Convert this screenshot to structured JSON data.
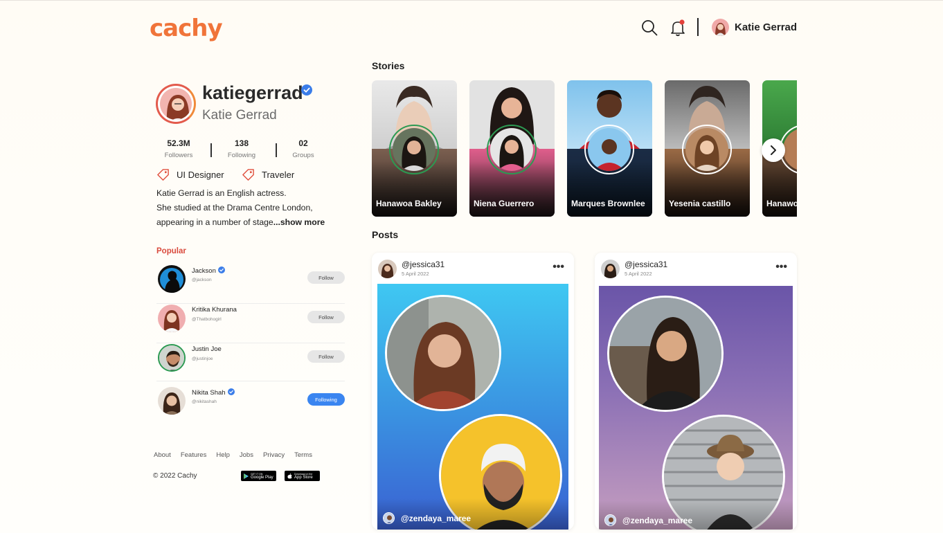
{
  "app": {
    "logo": "cachy"
  },
  "header": {
    "user_name": "Katie Gerrad"
  },
  "profile": {
    "username": "katiegerrad",
    "full_name": "Katie Gerrad",
    "stats": [
      {
        "value": "52.3M",
        "label": "Followers"
      },
      {
        "value": "138",
        "label": "Following"
      },
      {
        "value": "02",
        "label": "Groups"
      }
    ],
    "tags": [
      "UI Designer",
      "Traveler"
    ],
    "bio_lines": [
      "Katie Gerrad is an English actress.",
      "She studied at the Drama Centre London,",
      "appearing in a number of stage"
    ],
    "show_more": "...show more"
  },
  "popular": {
    "title": "Popular",
    "users": [
      {
        "name": "Jackson",
        "handle": "@jackson",
        "verified": true,
        "action": "Follow"
      },
      {
        "name": "Kritika Khurana",
        "handle": "@Thatbohogirl",
        "verified": false,
        "action": "Follow"
      },
      {
        "name": "Justin Joe",
        "handle": "@justinjoe",
        "verified": false,
        "action": "Follow"
      },
      {
        "name": "Nikita Shah",
        "handle": "@nikitashah",
        "verified": true,
        "action": "Following"
      }
    ]
  },
  "footer": {
    "links": [
      "About",
      "Features",
      "Help",
      "Jobs",
      "Privacy",
      "Terms"
    ],
    "copyright": "© 2022 Cachy",
    "google_play": "Google Play",
    "google_play_small": "GET IT ON",
    "app_store": "App Store",
    "app_store_small": "Download on the"
  },
  "stories": {
    "title": "Stories",
    "items": [
      {
        "name": "Hanawoa Bakley"
      },
      {
        "name": "Niena Guerrero"
      },
      {
        "name": "Marques Brownlee"
      },
      {
        "name": "Yesenia castillo"
      },
      {
        "name": "Hanawoa Bakley"
      }
    ]
  },
  "posts": {
    "title": "Posts",
    "items": [
      {
        "author": "@jessica31",
        "date": "5 April 2022",
        "tagged": "@zendaya_maree"
      },
      {
        "author": "@jessica31",
        "date": "5 April 2022",
        "tagged": "@zendaya_maree"
      }
    ]
  },
  "colors": {
    "accent": "#f0743a",
    "popular": "#d94a3d",
    "following": "#3a85f0",
    "story_ring": "#2c9a52"
  }
}
